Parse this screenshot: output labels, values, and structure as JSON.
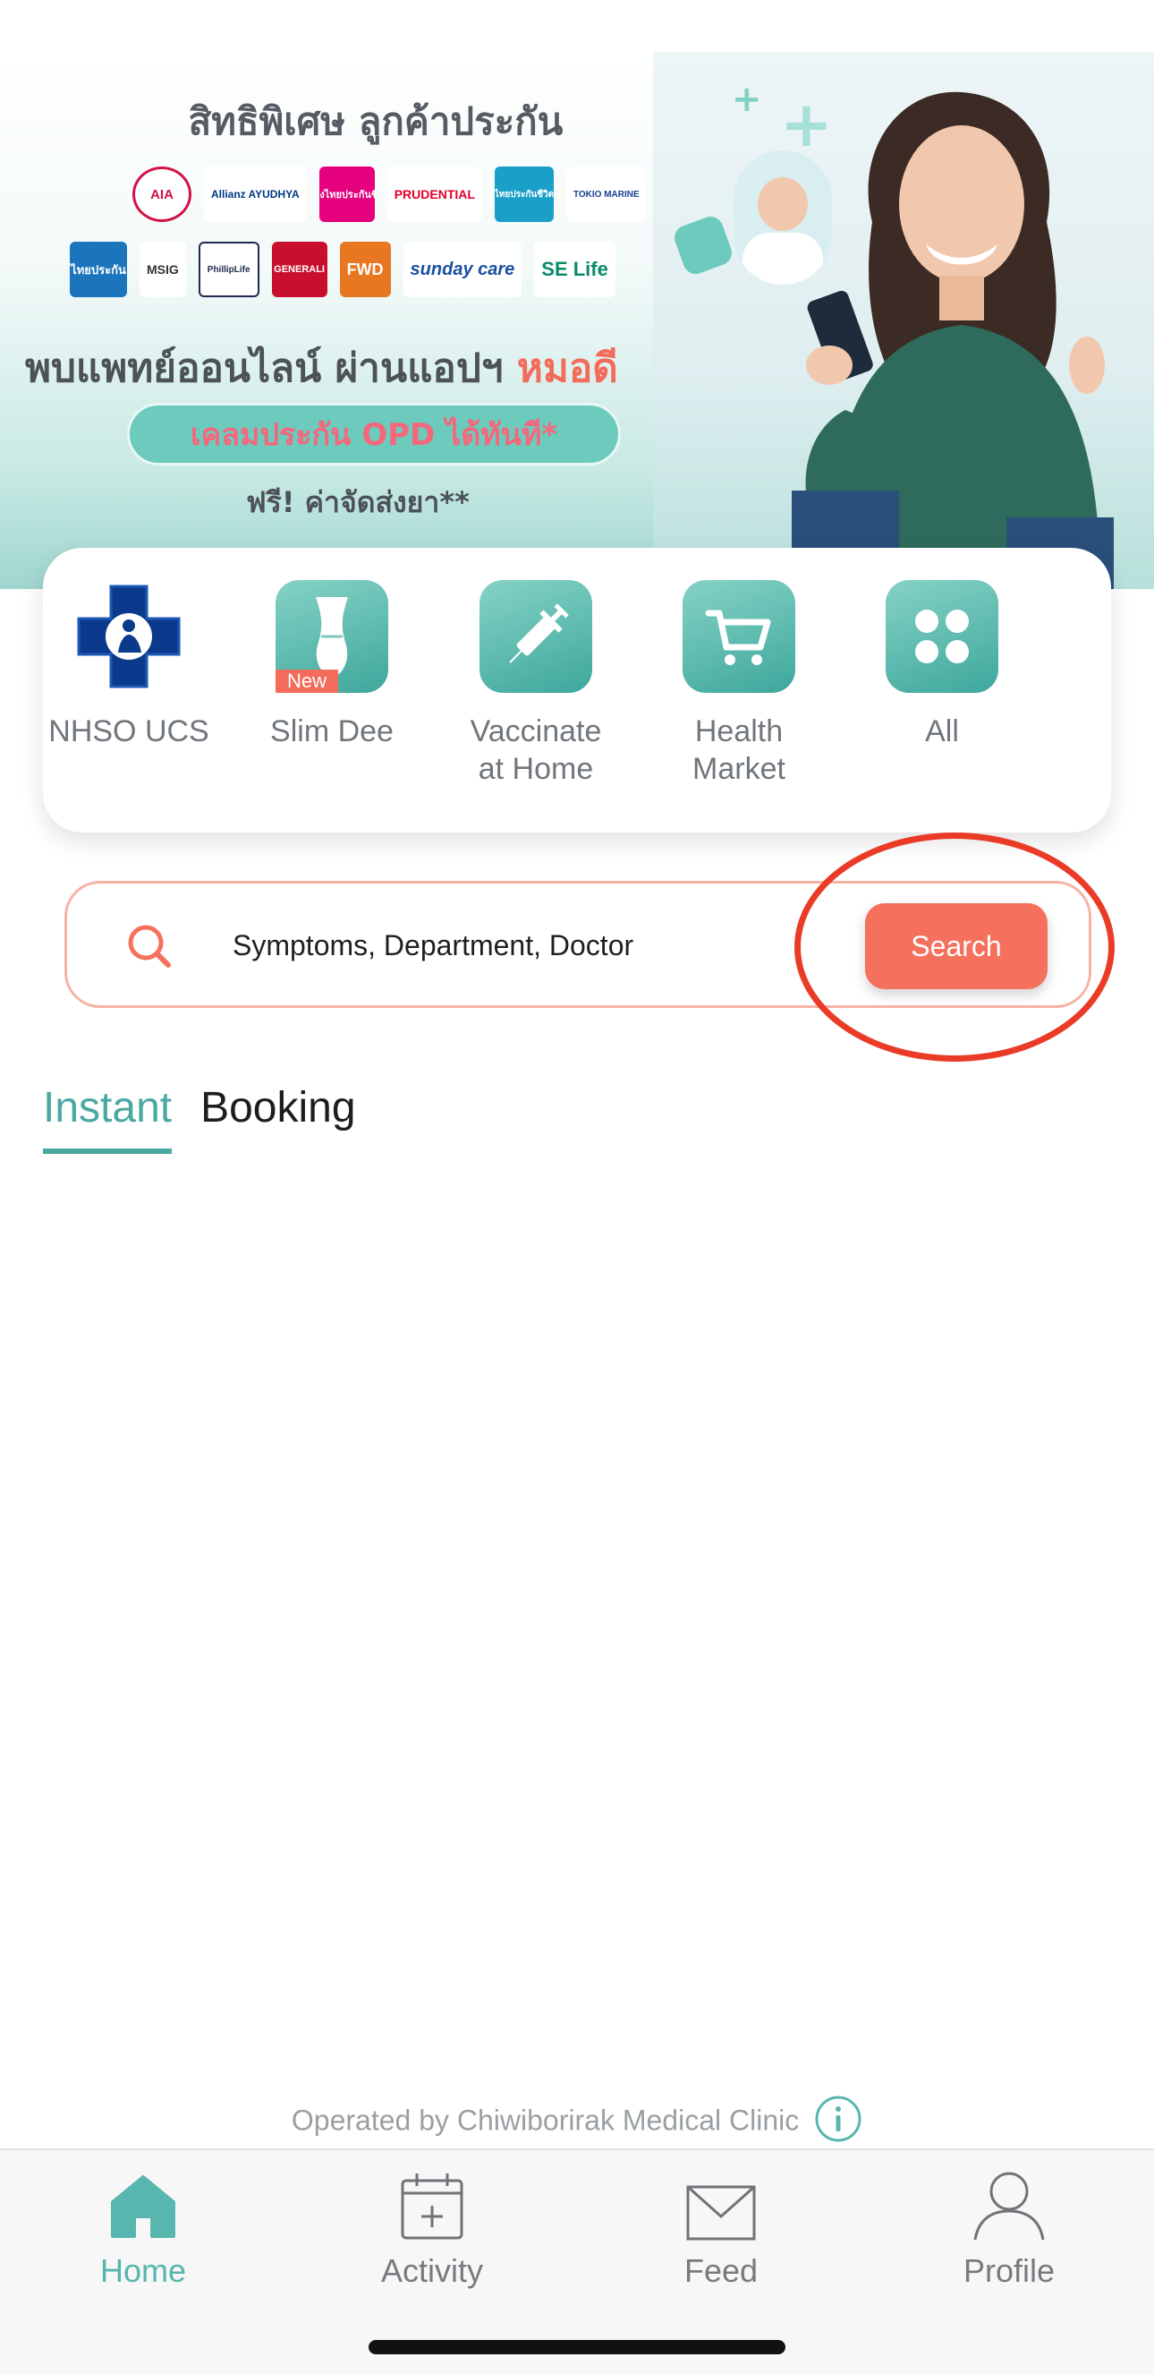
{
  "banner": {
    "title": "สิทธิพิเศษ ลูกค้าประกัน",
    "headline_prefix": "พบแพทย์ออนไลน์ ผ่านแอปฯ ",
    "headline_accent": "หมอดี",
    "pill": "เคลมประกัน OPD ได้ทันที*",
    "sub": "ฟรี! ค่าจัดส่งยา**",
    "logos_row1": [
      "AIA",
      "Allianz AYUDHYA",
      "เมืองไทยประกันชีวิต",
      "PRUDENTIAL",
      "ไทยประกันชีวิต",
      "TOKIO MARINE"
    ],
    "logos_row2": [
      "ไทยประกัน",
      "MSIG",
      "PhillipLife",
      "GENERALI",
      "FWD",
      "sunday care",
      "SE Life"
    ],
    "active_slide": 2,
    "slide_count": 8
  },
  "quick_menu": [
    {
      "label": "NHSO UCS",
      "icon": "nhso-logo-icon"
    },
    {
      "label": "Slim Dee",
      "icon": "slim-body-icon",
      "badge": "New"
    },
    {
      "label": "Vaccinate\nat Home",
      "icon": "syringe-icon"
    },
    {
      "label": "Health\nMarket",
      "icon": "cart-icon"
    },
    {
      "label": "All",
      "icon": "grid-icon"
    }
  ],
  "search": {
    "placeholder": "Symptoms, Department, Doctor",
    "button_label": "Search"
  },
  "tabs": {
    "instant": "Instant",
    "booking": "Booking"
  },
  "footer": {
    "operated_by": "Operated by Chiwiborirak Medical Clinic"
  },
  "nav": {
    "home": "Home",
    "activity": "Activity",
    "feed": "Feed",
    "profile": "Profile"
  },
  "colors": {
    "teal": "#4aa9a1",
    "coral": "#f5705d",
    "highlight": "#ea3b27"
  }
}
